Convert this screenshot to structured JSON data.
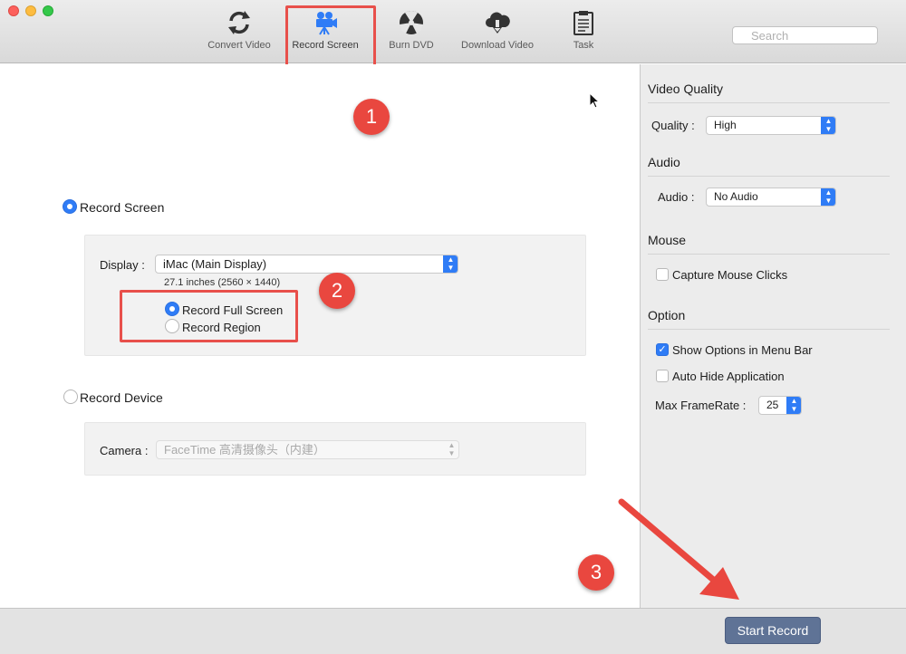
{
  "toolbar": {
    "items": [
      {
        "label": "Convert Video",
        "icon": "refresh-icon"
      },
      {
        "label": "Record Screen",
        "icon": "video-camera-icon"
      },
      {
        "label": "Burn DVD",
        "icon": "radiation-disc-icon"
      },
      {
        "label": "Download Video",
        "icon": "cloud-download-icon"
      },
      {
        "label": "Task",
        "icon": "clipboard-icon"
      }
    ],
    "active": "Record Screen",
    "search_placeholder": "Search"
  },
  "record_screen": {
    "label": "Record Screen",
    "display_label": "Display :",
    "display_value": "iMac (Main Display)",
    "display_info": "27.1 inches (2560 × 1440)",
    "full_screen_label": "Record Full Screen",
    "region_label": "Record Region"
  },
  "record_device": {
    "label": "Record Device",
    "camera_label": "Camera :",
    "camera_value": "FaceTime 高清摄像头（内建）"
  },
  "sidebar": {
    "video_quality_title": "Video Quality",
    "quality_label": "Quality :",
    "quality_value": "High",
    "audio_title": "Audio",
    "audio_label": "Audio :",
    "audio_value": "No Audio",
    "mouse_title": "Mouse",
    "capture_clicks_label": "Capture Mouse Clicks",
    "option_title": "Option",
    "show_options_label": "Show Options in Menu Bar",
    "auto_hide_label": "Auto Hide Application",
    "max_framerate_label": "Max FrameRate :",
    "max_framerate_value": "25"
  },
  "annotations": [
    "1",
    "2",
    "3"
  ],
  "start_button_label": "Start Record",
  "colors": {
    "accent": "#2f7cf6",
    "annotation": "#e9473f",
    "start_button": "#5f7396"
  }
}
